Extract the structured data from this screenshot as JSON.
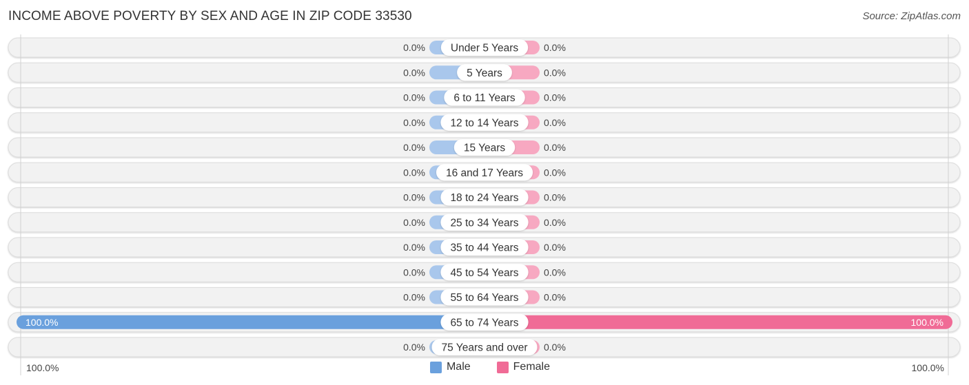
{
  "header": {
    "title": "INCOME ABOVE POVERTY BY SEX AND AGE IN ZIP CODE 33530",
    "source": "Source: ZipAtlas.com"
  },
  "colors": {
    "male": "#6aa0dd",
    "male_light": "#a9c7ec",
    "female": "#f06b96",
    "female_light": "#f7a8c1",
    "row_bg": "#f2f2f2"
  },
  "axis": {
    "left_label": "100.0%",
    "right_label": "100.0%"
  },
  "legend": {
    "male_label": "Male",
    "female_label": "Female"
  },
  "chart_data": {
    "type": "bar",
    "orientation": "horizontal-diverging",
    "title": "INCOME ABOVE POVERTY BY SEX AND AGE IN ZIP CODE 33530",
    "xlabel": "",
    "ylabel": "",
    "xlim": [
      -100,
      100
    ],
    "legend_position": "bottom",
    "categories": [
      "Under 5 Years",
      "5 Years",
      "6 to 11 Years",
      "12 to 14 Years",
      "15 Years",
      "16 and 17 Years",
      "18 to 24 Years",
      "25 to 34 Years",
      "35 to 44 Years",
      "45 to 54 Years",
      "55 to 64 Years",
      "65 to 74 Years",
      "75 Years and over"
    ],
    "series": [
      {
        "name": "Male",
        "values": [
          0,
          0,
          0,
          0,
          0,
          0,
          0,
          0,
          0,
          0,
          0,
          100,
          0
        ],
        "labels": [
          "0.0%",
          "0.0%",
          "0.0%",
          "0.0%",
          "0.0%",
          "0.0%",
          "0.0%",
          "0.0%",
          "0.0%",
          "0.0%",
          "0.0%",
          "100.0%",
          "0.0%"
        ]
      },
      {
        "name": "Female",
        "values": [
          0,
          0,
          0,
          0,
          0,
          0,
          0,
          0,
          0,
          0,
          0,
          100,
          0
        ],
        "labels": [
          "0.0%",
          "0.0%",
          "0.0%",
          "0.0%",
          "0.0%",
          "0.0%",
          "0.0%",
          "0.0%",
          "0.0%",
          "0.0%",
          "0.0%",
          "100.0%",
          "0.0%"
        ]
      }
    ],
    "axis_tick_labels": [
      "100.0%",
      "100.0%"
    ]
  }
}
